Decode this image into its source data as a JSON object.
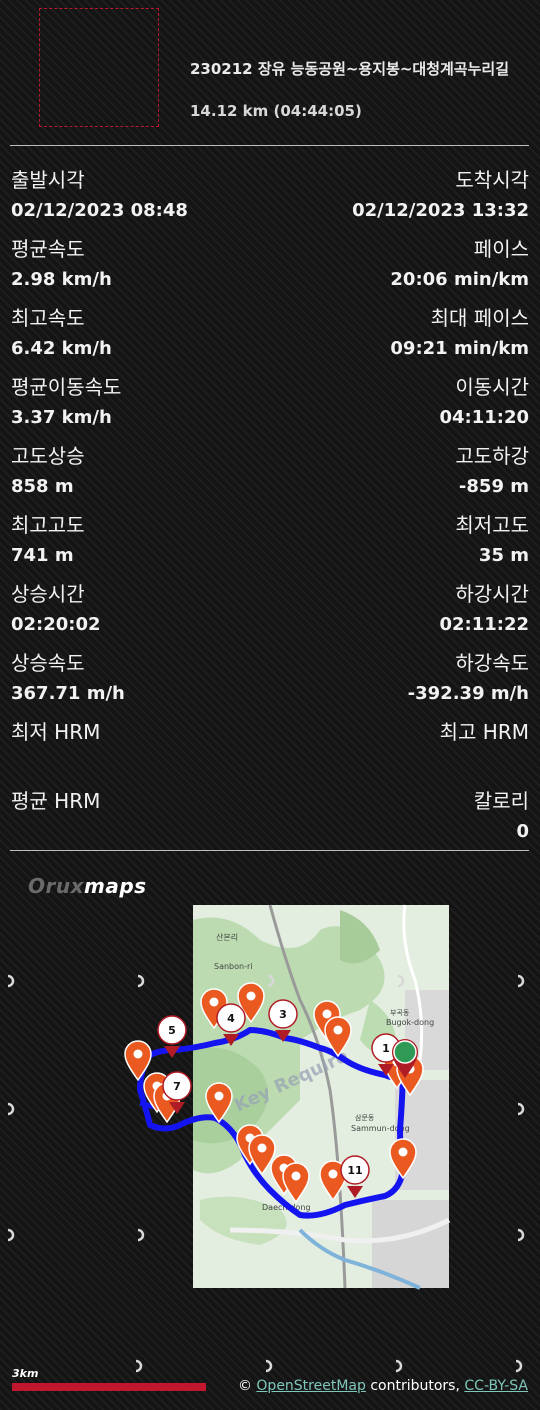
{
  "header": {
    "title": "230212 장유 능동공원~용지봉~대청계곡누리길",
    "distance": "14.12 km (04:44:05)"
  },
  "stats": [
    {
      "left_label": "출발시각",
      "left_value": "02/12/2023 08:48",
      "right_label": "도착시각",
      "right_value": "02/12/2023 13:32"
    },
    {
      "left_label": "평균속도",
      "left_value": "2.98 km/h",
      "right_label": "페이스",
      "right_value": "20:06 min/km"
    },
    {
      "left_label": "최고속도",
      "left_value": "6.42 km/h",
      "right_label": "최대 페이스",
      "right_value": "09:21 min/km"
    },
    {
      "left_label": "평균이동속도",
      "left_value": "3.37 km/h",
      "right_label": "이동시간",
      "right_value": "04:11:20"
    },
    {
      "left_label": "고도상승",
      "left_value": "858 m",
      "right_label": "고도하강",
      "right_value": "-859 m"
    },
    {
      "left_label": "최고고도",
      "left_value": "741 m",
      "right_label": "최저고도",
      "right_value": "35 m"
    },
    {
      "left_label": "상승시간",
      "left_value": "02:20:02",
      "right_label": "하강시간",
      "right_value": "02:11:22"
    },
    {
      "left_label": "상승속도",
      "left_value": "367.71 m/h",
      "right_label": "하강속도",
      "right_value": "-392.39 m/h"
    },
    {
      "left_label": "최저 HRM",
      "left_value": "",
      "right_label": "최고 HRM",
      "right_value": ""
    },
    {
      "left_label": "평균 HRM",
      "left_value": "",
      "right_label": "칼로리",
      "right_value": "0"
    }
  ],
  "map": {
    "brand_part1": "Oruxmaps",
    "brand_part2": "maps",
    "labels": {
      "sanbon": "산본리",
      "sanbon_en": "Sanbon-ri",
      "bugok": "부곡동",
      "bugok_en": "Bugok-dong",
      "sammun": "삼문동",
      "sammun_en": "Sammun-dong",
      "daecheong": "Daech-dong",
      "watermark": "Key Require"
    },
    "waypoints": [
      "1",
      "3",
      "4",
      "5",
      "7",
      "11"
    ],
    "scale_label": "3km",
    "attribution": {
      "prefix": "©",
      "osm": "OpenStreetMap",
      "middle": "contributors,",
      "license": "CC-BY-SA"
    },
    "colors": {
      "route": "#1414f0",
      "marker": "#ea5a20",
      "marker_dark": "#b01c26",
      "start": "#2f9a55",
      "scale": "#c0162e"
    }
  }
}
